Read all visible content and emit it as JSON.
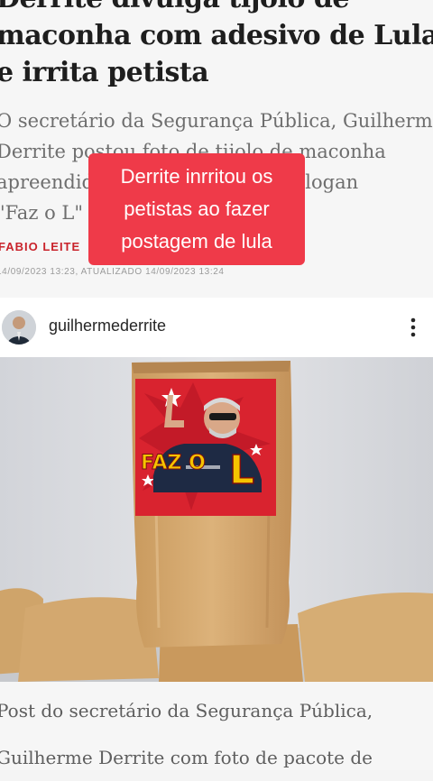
{
  "article": {
    "headline_lines": [
      "Derrite divulga tijolo de",
      "maconha com adesivo de Lula",
      "e irrita petista"
    ],
    "subtitle_lines": [
      "O secretário da Segurança Pública, Guilherme",
      "Derrite postou foto de tijolo de maconha",
      "apreendido com foto de Lula e slogan",
      "\"Faz o L\""
    ],
    "author": "FABIO LEITE",
    "dates": "14/09/2023 13:23, ATUALIZADO 14/09/2023 13:24",
    "caption_lines": [
      "Post do secretário da Segurança Pública,",
      "Guilherme Derrite com foto de pacote de"
    ]
  },
  "overlay": {
    "lines": [
      "Derrite inrritou os",
      "petistas ao fazer",
      "postagem de lula"
    ]
  },
  "post": {
    "username": "guilhermederrite",
    "sticker_text": "FAZ O L"
  },
  "colors": {
    "overlay_bg": "#ef3a49",
    "author": "#c9232b",
    "sticker_bg": "#d9232f",
    "sticker_l": "#f5c400"
  },
  "icons": [
    "more-vertical-icon"
  ]
}
